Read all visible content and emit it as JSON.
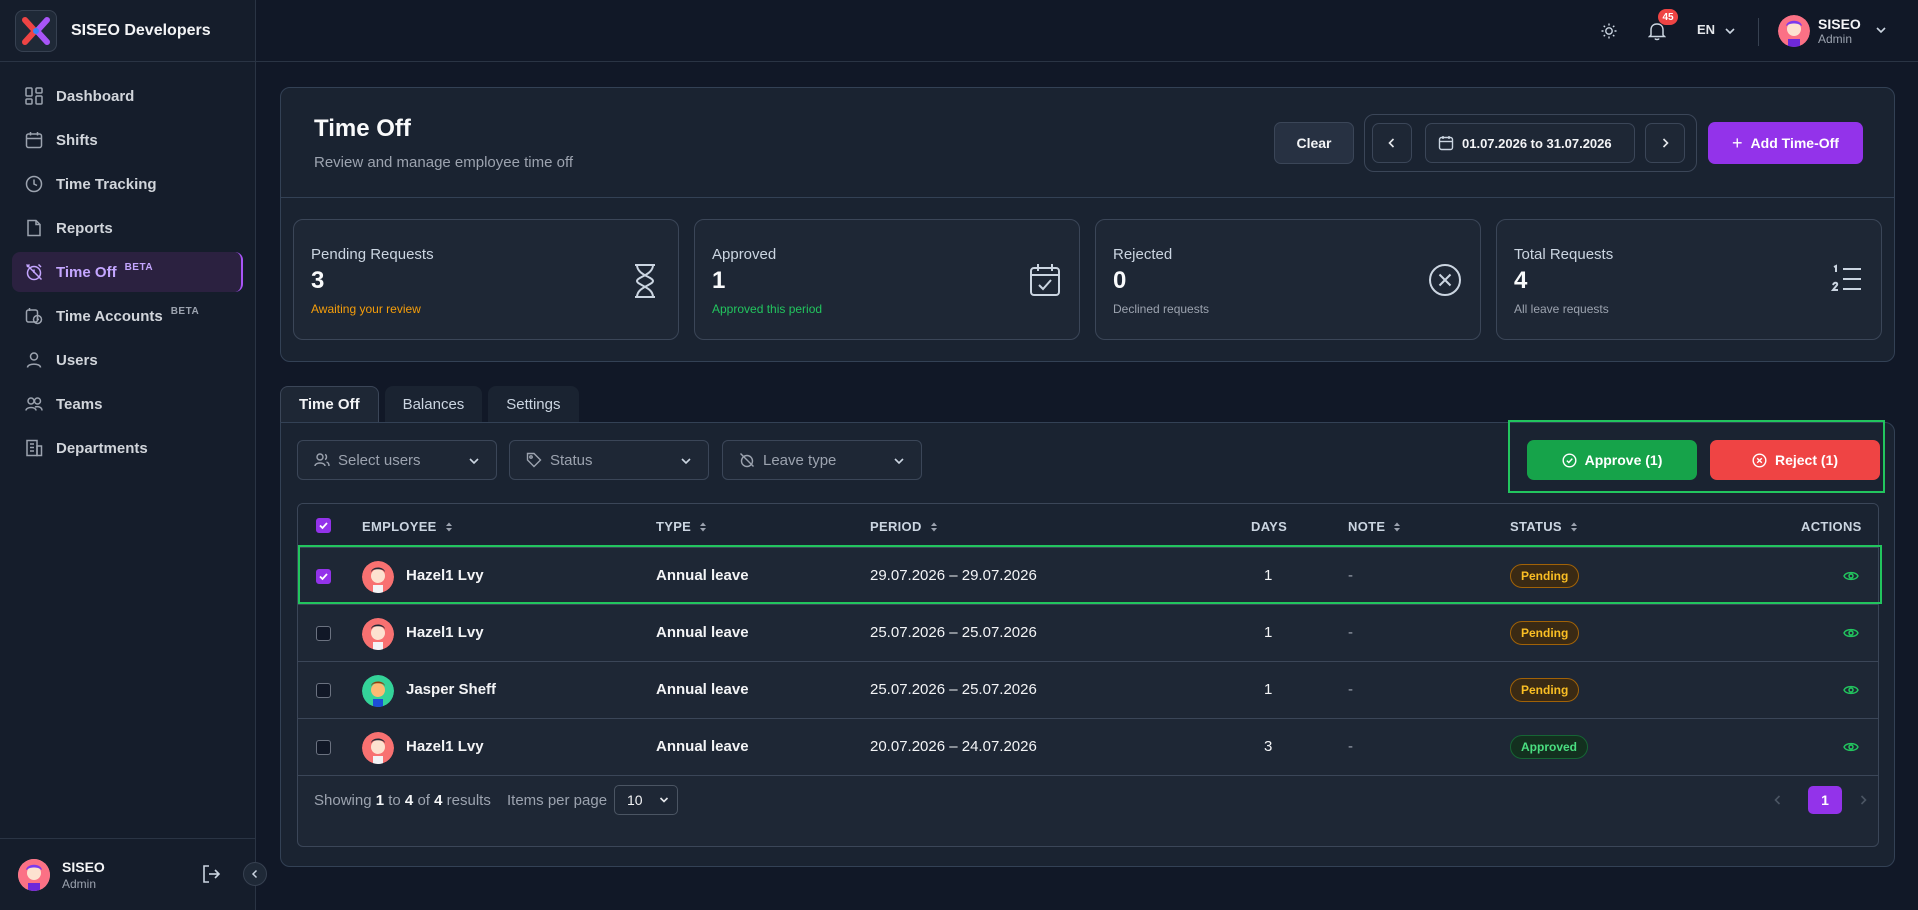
{
  "app": {
    "name": "SISEO Developers"
  },
  "sidebar": {
    "items": [
      {
        "label": "Dashboard",
        "icon": "dashboard-icon"
      },
      {
        "label": "Shifts",
        "icon": "calendar-icon"
      },
      {
        "label": "Time Tracking",
        "icon": "clock-icon"
      },
      {
        "label": "Reports",
        "icon": "file-icon"
      },
      {
        "label": "Time Off",
        "icon": "alarm-off-icon",
        "badge": "BETA",
        "active": true
      },
      {
        "label": "Time Accounts",
        "icon": "clock-history-icon",
        "badge": "BETA"
      },
      {
        "label": "Users",
        "icon": "user-icon"
      },
      {
        "label": "Teams",
        "icon": "users-icon"
      },
      {
        "label": "Departments",
        "icon": "building-icon"
      }
    ],
    "user": {
      "name": "SISEO",
      "role": "Admin"
    }
  },
  "topbar": {
    "notifications": "45",
    "language": "EN",
    "user": {
      "name": "SISEO",
      "role": "Admin"
    }
  },
  "page": {
    "title": "Time Off",
    "subtitle": "Review and manage employee time off",
    "clear_label": "Clear",
    "date_range": "01.07.2026 to 31.07.2026",
    "add_label": "Add Time-Off"
  },
  "stats": [
    {
      "label": "Pending Requests",
      "value": "3",
      "hint": "Awaiting your review",
      "hint_color": "#f59e0b",
      "icon": "hourglass-icon"
    },
    {
      "label": "Approved",
      "value": "1",
      "hint": "Approved this period",
      "hint_color": "#22c55e",
      "icon": "calendar-check-icon"
    },
    {
      "label": "Rejected",
      "value": "0",
      "hint": "Declined requests",
      "hint_color": "#9ca3af",
      "icon": "x-circle-icon"
    },
    {
      "label": "Total Requests",
      "value": "4",
      "hint": "All leave requests",
      "hint_color": "#9ca3af",
      "icon": "list-ordered-icon"
    }
  ],
  "tabs": [
    "Time Off",
    "Balances",
    "Settings"
  ],
  "filters": {
    "users": "Select users",
    "status": "Status",
    "leave_type": "Leave type"
  },
  "bulk": {
    "approve": "Approve (1)",
    "reject": "Reject (1)"
  },
  "table": {
    "headers": {
      "employee": "EMPLOYEE",
      "type": "TYPE",
      "period": "PERIOD",
      "days": "DAYS",
      "note": "NOTE",
      "status": "STATUS",
      "actions": "ACTIONS"
    },
    "rows": [
      {
        "employee": "Hazel1 Lvy",
        "type": "Annual leave",
        "period": "29.07.2026 – 29.07.2026",
        "days": "1",
        "note": "-",
        "status": "Pending",
        "checked": true
      },
      {
        "employee": "Hazel1 Lvy",
        "type": "Annual leave",
        "period": "25.07.2026 – 25.07.2026",
        "days": "1",
        "note": "-",
        "status": "Pending",
        "checked": false
      },
      {
        "employee": "Jasper Sheff",
        "type": "Annual leave",
        "period": "25.07.2026 – 25.07.2026",
        "days": "1",
        "note": "-",
        "status": "Pending",
        "checked": false
      },
      {
        "employee": "Hazel1 Lvy",
        "type": "Annual leave",
        "period": "20.07.2026 – 24.07.2026",
        "days": "3",
        "note": "-",
        "status": "Approved",
        "checked": false
      }
    ]
  },
  "footer": {
    "showing_prefix": "Showing",
    "from": "1",
    "to_word": "to",
    "to": "4",
    "of_word": "of",
    "total": "4",
    "results_word": "results",
    "items_per_page_label": "Items per page",
    "items_per_page": "10",
    "current_page": "1"
  },
  "colors": {
    "accent": "#9333ea",
    "approve": "#16a34a",
    "reject": "#ef4444",
    "pending": "#fbbf24",
    "approved": "#4ade80"
  }
}
